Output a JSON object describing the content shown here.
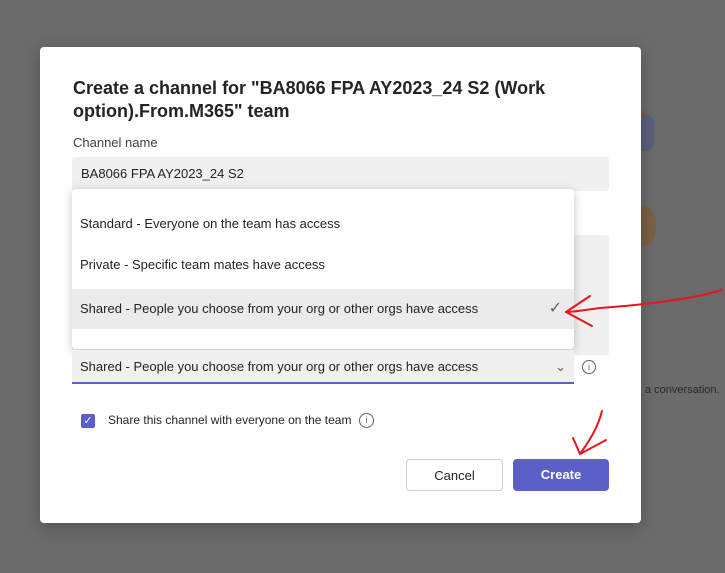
{
  "dialog": {
    "title": "Create a channel for \"BA8066 FPA AY2023_24 S2 (Work option).From.M365\" team",
    "channel_name_label": "Channel name",
    "channel_name_value": "BA8066 FPA AY2023_24 S2",
    "privacy_options": [
      "Standard - Everyone on the team has access",
      "Private - Specific team mates have access",
      "Shared - People you choose from your org or other orgs have access"
    ],
    "privacy_selected": "Shared - People you choose from your org or other orgs have access",
    "share_checkbox_label": "Share this channel with everyone on the team",
    "share_checkbox_checked": true,
    "cancel_label": "Cancel",
    "create_label": "Create"
  },
  "background": {
    "conversation_text": "a conversation."
  },
  "colors": {
    "accent": "#5b5fc7",
    "annotation": "#e8141e"
  },
  "icons": [
    "check-icon",
    "chevron-down-icon",
    "info-icon",
    "checkbox-checked-icon"
  ]
}
